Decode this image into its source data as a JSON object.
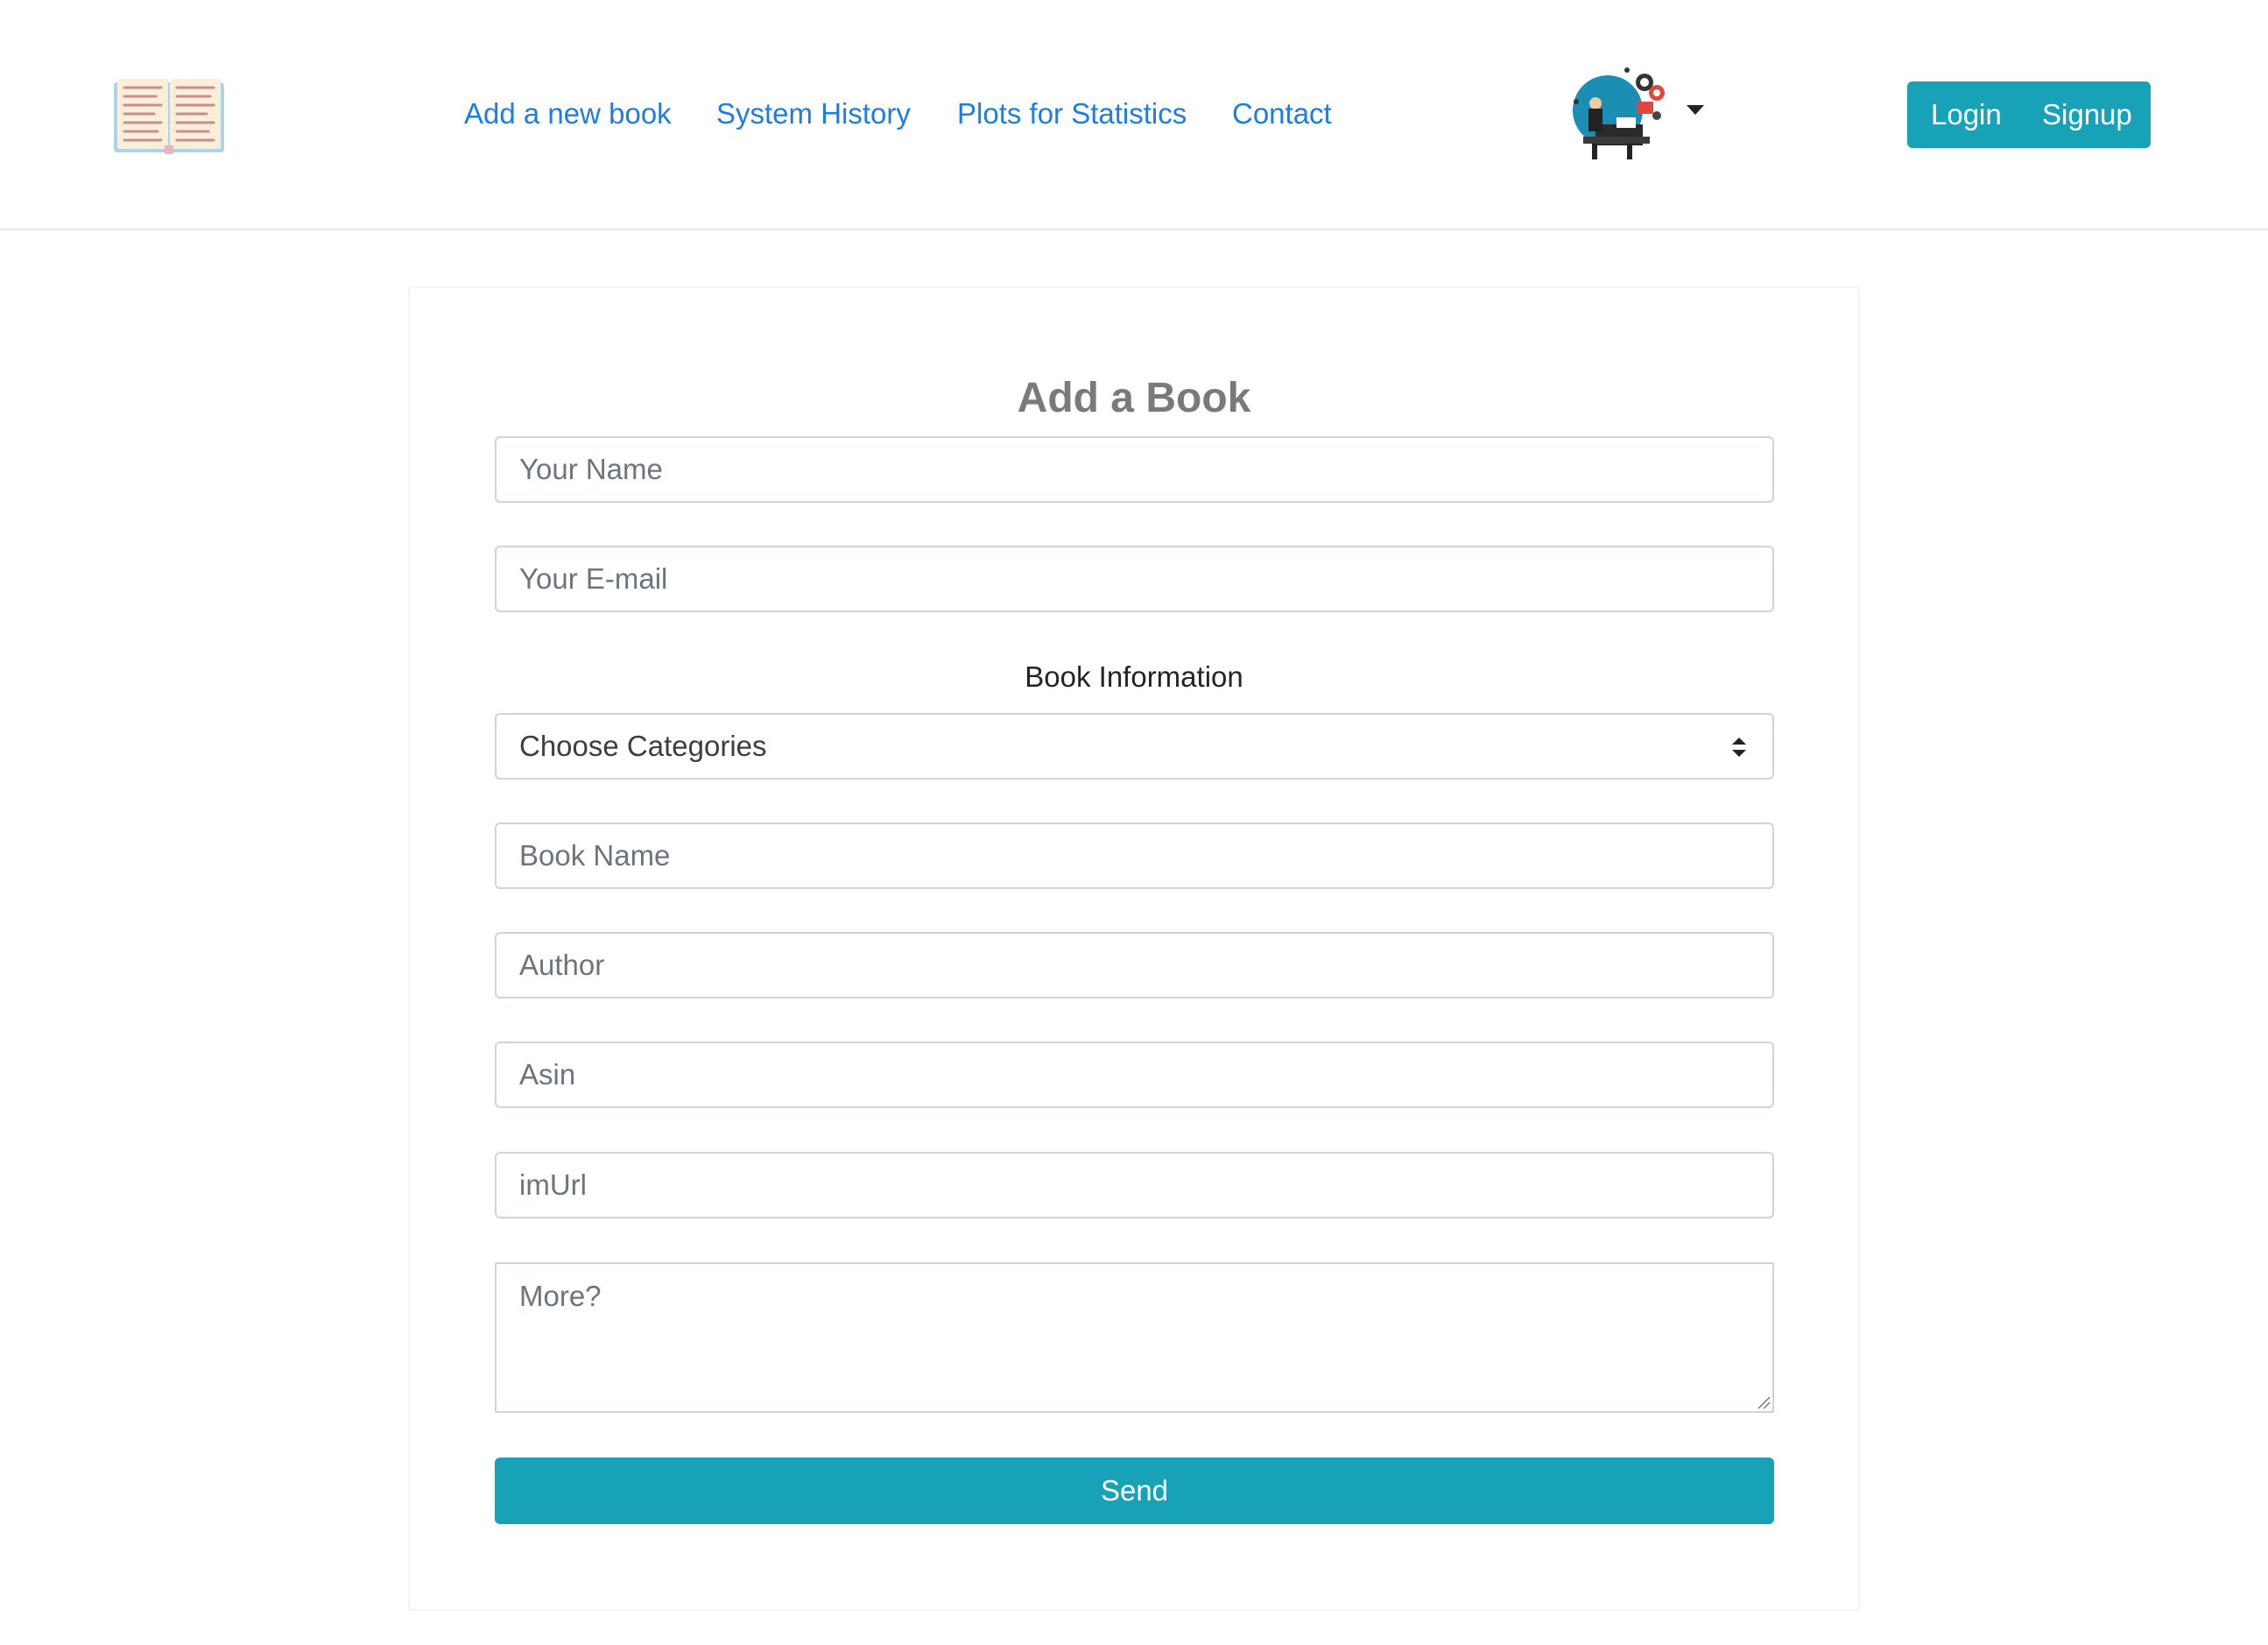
{
  "header": {
    "logo_icon": "open-book-icon",
    "nav": [
      {
        "label": "Add a new book"
      },
      {
        "label": "System History"
      },
      {
        "label": "Plots for Statistics"
      },
      {
        "label": "Contact"
      }
    ],
    "avatar_icon": "user-avatar-icon",
    "dropdown_icon": "caret-down-icon",
    "login_label": "Login",
    "signup_label": "Signup"
  },
  "form": {
    "title": "Add a Book",
    "name_placeholder": "Your Name",
    "email_placeholder": "Your E-mail",
    "section_label": "Book Information",
    "category_selected": "Choose Categories",
    "book_name_placeholder": "Book Name",
    "author_placeholder": "Author",
    "asin_placeholder": "Asin",
    "imurl_placeholder": "imUrl",
    "more_placeholder": "More?",
    "send_label": "Send"
  },
  "colors": {
    "accent": "#17a2b8",
    "link": "#1f7ce0",
    "title_gray": "#7a7a7a",
    "border": "#ced4da"
  }
}
